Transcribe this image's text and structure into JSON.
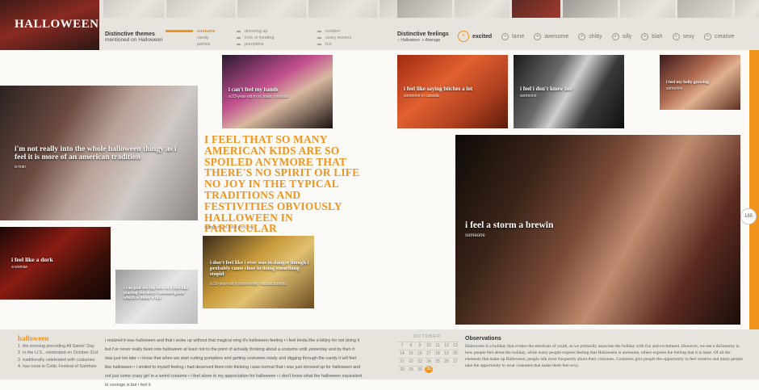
{
  "header": {
    "title": "HALLOWEEN",
    "themes_label": "Distinctive themes",
    "themes_sub": "mentioned on Halloween",
    "themes_col1": [
      "costume",
      "candy",
      "parties"
    ],
    "themes_col2": [
      "dressing up",
      "trick or treating",
      "pumpkins"
    ],
    "themes_col3": [
      "october",
      "scary movies",
      "fun"
    ],
    "feelings_label": "Distinctive feelings",
    "feelings_legend_halloween": "Halloween",
    "feelings_legend_average": "Average",
    "feelings": [
      "excited",
      "lame",
      "awesome",
      "shitty",
      "silly",
      "blah",
      "sexy",
      "creative"
    ]
  },
  "photos": [
    {
      "cap": "i can't feel my hands",
      "sub": "a 23-year-old in st. louis, missouri"
    },
    {
      "cap": "i'm not really into the whole halloween thingy as i feel it is more of an american tradition",
      "sub": "a man"
    },
    {
      "cap": "i feel like a dork",
      "sub": "a woman"
    },
    {
      "cap": "i can pull the top bow of a feel like playing the slutty costume game which is likely a fall",
      "sub": ""
    },
    {
      "cap": "i don't feel like i ever was in danger though i probably came close to doing something stupid",
      "sub": "a 31-year-old in somerville, massachusetts"
    },
    {
      "cap": "i feel like saying bitches a lot",
      "sub": "someone in canada"
    },
    {
      "cap": "i feel i don't know her",
      "sub": "someone"
    },
    {
      "cap": "i feel my belly growing",
      "sub": "someone"
    },
    {
      "cap": "i feel a storm a brewin",
      "sub": "someone"
    }
  ],
  "quote": {
    "text": "I FEEL THAT SO MANY AMERICAN KIDS ARE SO SPOILED ANYMORE THAT THERE'S NO SPIRIT OR LIFE NO JOY IN THE TYPICAL TRADITIONS AND FESTIVITIES OBVIOUSLY HALLOWEEN IN PARTICULAR",
    "attribution": "someone in new york city"
  },
  "page_number": "165",
  "footer": {
    "title": "halloween",
    "defs": [
      "1. the evening preceding All Saints' Day",
      "2. In the U.S., celebrated on October 31st",
      "3. traditionally celebrated with costumes",
      "4. has roots in Celtic Festival of Samhain"
    ],
    "stories": "i realized it was halloween and that i woke up without that magical omg it's halloween feeling • i feel kinda like a killjoy for not doing it but i've never really been into halloween at least not to the point of actually thinking about a costume until yesterday and by then it was just too late • i know that when we start cutting pumpkins and getting costumes ready and digging through the candy it will feel like halloween • i smiled to myself feeling i had deserved them into thinking i was normal that i was just dressed up for halloween and not just some crazy girl in a weird costume • i feel alone in my appreciation for halloween • i don't know what the halloween equivalent to scrooge is but i feel it",
    "calendar_month": "OCTOBER",
    "calendar_days": [
      "",
      "",
      "",
      "",
      "",
      "",
      "",
      "",
      "",
      "",
      "",
      "",
      "",
      "",
      "",
      "",
      "",
      "",
      "",
      "",
      "",
      "",
      "7",
      "8",
      "9",
      "10",
      "11",
      "12",
      "13",
      "14",
      "15",
      "16",
      "17",
      "18",
      "19",
      "20",
      "21",
      "22",
      "23",
      "24",
      "25",
      "26",
      "27",
      "28",
      "29",
      "30",
      "31"
    ],
    "obs_title": "Observations",
    "obs_text": "Halloween is a holiday that evokes the emotions of youth, as we primarily associate the holiday with fun and excitement. However, we see a dichotomy in how people feel about the holiday, while many people express feeling that Halloween is awesome, others express the feeling that it is lame. Of all the elements that make up Halloween, people talk most frequently about their costumes. Costumes give people the opportunity to feel creative and many people take the opportunity to wear costumes that make them feel sexy."
  },
  "colors": {
    "accent": "#f0941e",
    "panel": "#e7e4dd"
  }
}
